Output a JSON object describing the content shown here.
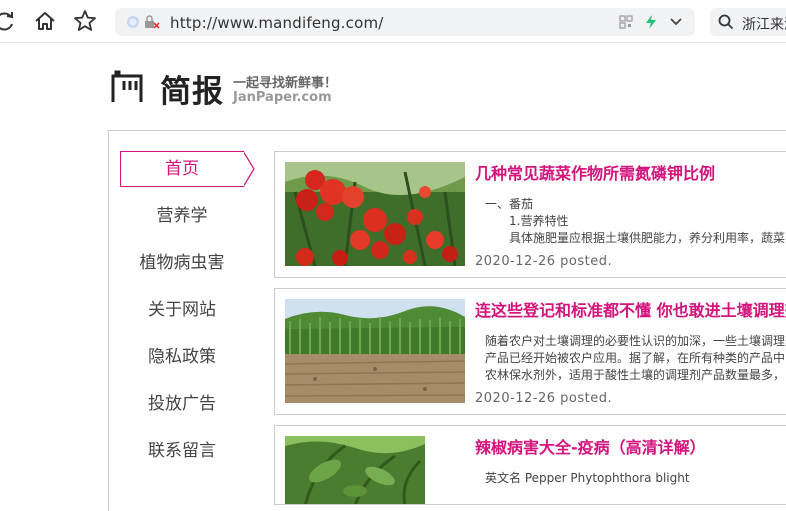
{
  "browser": {
    "url": "http://www.mandifeng.com/",
    "search_text": "浙江来源",
    "icons": [
      "reload-icon",
      "home-icon",
      "star-icon",
      "security-icon",
      "blocked-icon",
      "qrcode-icon",
      "lightning-icon",
      "chevron-down-icon",
      "search-icon"
    ],
    "accent": "#21c07a"
  },
  "site": {
    "title": "简报",
    "slogan": "一起寻找新鲜事！",
    "domain": "JanPaper.com",
    "accent_color": "#d4147d"
  },
  "nav": {
    "items": [
      {
        "label": "首页",
        "active": true
      },
      {
        "label": "营养学"
      },
      {
        "label": "植物病虫害"
      },
      {
        "label": "关于网站"
      },
      {
        "label": "隐私政策"
      },
      {
        "label": "投放广告"
      },
      {
        "label": "联系留言"
      }
    ]
  },
  "articles": [
    {
      "title": "几种常见蔬菜作物所需氮磷钾比例",
      "lines": [
        "一、番茄",
        "1.营养特性",
        "具体施肥量应根据土壤供肥能力，养分利用率，蔬菜"
      ],
      "date": "2020-12-26 posted."
    },
    {
      "title": "连这些登记和标准都不懂 你也敢进土壤调理剂",
      "lines": [
        "随着农户对土壤调理的必要性认识的加深，一些土壤调理剂",
        "产品已经开始被农户应用。据了解，在所有种类的产品中",
        "农林保水剂外，适用于酸性土壤的调理剂产品数量最多，"
      ],
      "date": "2020-12-26 posted."
    },
    {
      "title": "辣椒病害大全-疫病（高清详解）",
      "lines": [
        "英文名 Pepper Phytophthora blight"
      ],
      "date": ""
    }
  ]
}
